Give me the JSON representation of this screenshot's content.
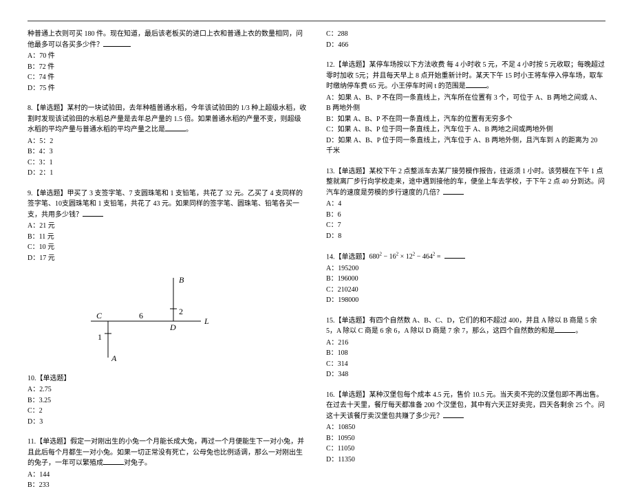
{
  "left": {
    "q7": {
      "stem_cont": "种普通上衣则可买 180 件。现在知道，最后该老板买的进口上衣和普通上衣的数量相同，问他最多可以各买多少件？",
      "A": "A：70 件",
      "B": "B：72 件",
      "C": "C：74 件",
      "D": "D：75 件"
    },
    "q8": {
      "stem": "8.【单选题】某村的一块试验田，去年种植普通水稻，今年该试验田的 1/3 种上超级水稻，收割时发现该试验田的水稻总产量是去年总产量的 1.5 倍。如果普通水稻的产量不变，则超级水稻的平均产量与普通水稻的平均产量之比是",
      "A": "A：5：2",
      "B": "B：4：3",
      "C": "C：3：1",
      "D": "D：2：1"
    },
    "q9": {
      "stem": "9.【单选题】甲买了 3 支签字笔、7 支圆珠笔和 1 支铅笔，共花了 32 元。乙买了 4 支同样的签字笔、10支圆珠笔和 1 支铅笔，共花了 43 元。如果同样的签字笔、圆珠笔、铅笔各买一支，共用多少钱？",
      "A": "A：21 元",
      "B": "B：11 元",
      "C": "C：10 元",
      "D": "D：17 元"
    },
    "q10": {
      "stem": "10.【单选题】",
      "A": "A：2.75",
      "B": "B：3.25",
      "C": "C：2",
      "D": "D：3"
    },
    "q11": {
      "stem": "11.【单选题】假定一对刚出生的小兔一个月能长成大兔，再过一个月便能生下一对小兔，并且此后每个月都生一对小兔。如果一切正常没有死亡，公母兔也比例适调，那么一对刚出生的兔子，一年可以繁殖成",
      "stem_tail": "对兔子。",
      "A": "A：144",
      "B": "B：233"
    },
    "figure": {
      "B": "B",
      "two": "2",
      "C": "C",
      "six": "6",
      "D": "D",
      "L": "L",
      "one": "1",
      "A": "A"
    }
  },
  "right": {
    "q11cd": {
      "C": "C：288",
      "D": "D：466"
    },
    "q12": {
      "stem": "12.【单选题】某停车场按以下方法收费 每 4 小时收 5 元，不足 4 小时按 5 元收取；每晚超过零时加收 5元；并且每天早上 8 点开始重新计时。某天下午 15 时小王将车停入停车场，取车时缴纳停车费 65 元。小王停车时间 t 的范围是",
      "A": "A：如果 A、B、P 不在同一条直线上，汽车所在位置有 3 个，可位于 A、B 两地之间或 A、B 两地外侧",
      "B": "B：如果 A、B、P 不在同一条直线上，汽车的位置有无穷多个",
      "C": "C：如果 A、B、P 位于同一条直线上，汽车位于 A、B 两地之间或两地外侧",
      "D": "D：如果 A、B、P 位于同一条直线上，汽车位于 A、B 两地外侧，且汽车到 A 的距离为 20 千米"
    },
    "q13": {
      "stem": "13.【单选题】某校下午 2 点整派车去某厂接劳模作报告，往返须 1 小时。该劳模在下午 1 点整就离厂步行向学校走来，途中遇到接他的车，便坐上车去学校，于下午 2 点 40 分到达。问汽车的速度是劳模的步行速度的几倍？",
      "A": "A：4",
      "B": "B：6",
      "C": "C：7",
      "D": "D：8"
    },
    "q14": {
      "stem_prefix": "14.【单选题】",
      "formula_html": "680<sup>2</sup> − 16<sup>2</sup> × 12<sup>2</sup> − 464<sup>2</sup> =",
      "A": "A：195200",
      "B": "B：196000",
      "C": "C：210240",
      "D": "D：198000"
    },
    "q15": {
      "stem": "15.【单选题】有四个自然数 A、B、C、D，它们的和不超过 400，并且 A 除以 B 商是 5 余 5，A 除以 C 商是 6 余 6，A 除以 D 商是 7 余 7，那么，这四个自然数的和是",
      "A": "A：216",
      "B": "B：108",
      "C": "C：314",
      "D": "D：348"
    },
    "q16": {
      "stem": "16.【单选题】某种汉堡包每个成本 4.5 元，售价 10.5 元。当天卖不完的汉堡包即不再出售。在过去十天里，餐厅每天都准备 200 个汉堡包，其中有六天正好卖完，四天各剩余 25 个。问这十天该餐厅卖汉堡包共赚了多少元？",
      "A": "A：10850",
      "B": "B：10950",
      "C": "C：11050",
      "D": "D：11350"
    }
  }
}
